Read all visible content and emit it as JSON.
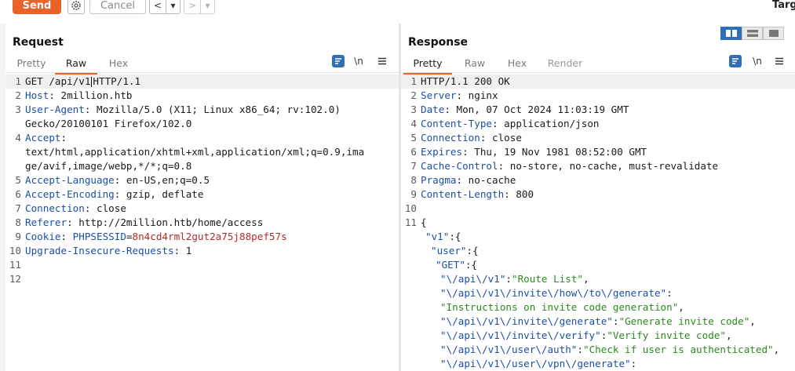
{
  "toolbar": {
    "send_label": "Send",
    "cancel_label": "Cancel",
    "back_label": "<",
    "back_dropdown_label": "▾",
    "forward_label": ">",
    "forward_dropdown_label": "▾",
    "target_label": "Targ"
  },
  "request": {
    "title": "Request",
    "tabs": [
      "Pretty",
      "Raw",
      "Hex"
    ],
    "active_tab": "Raw",
    "newline_label": "\\n",
    "lines": {
      "l1_a": "GET /api/v1",
      "l1_b": "HTTP/1.1",
      "l2_k": "Host",
      "l2_v": "2million.htb",
      "l3_k": "User-Agent",
      "l3_v": "Mozilla/5.0 (X11; Linux x86_64; rv:102.0)",
      "l3_c": "Gecko/20100101 Firefox/102.0",
      "l4_k": "Accept",
      "l4_c1": "text/html,application/xhtml+xml,application/xml;q=0.9,ima",
      "l4_c2": "ge/avif,image/webp,*/*;q=0.8",
      "l5_k": "Accept-Language",
      "l5_v": "en-US,en;q=0.5",
      "l6_k": "Accept-Encoding",
      "l6_v": "gzip, deflate",
      "l7_k": "Connection",
      "l7_v": "close",
      "l8_k": "Referer",
      "l8_v": "http://2million.htb/home/access",
      "l9_k": "Cookie",
      "l9_ck": "PHPSESSID",
      "l9_cv": "8n4cd4rml2gut2a75j88pef57s",
      "l10_k": "Upgrade-Insecure-Requests",
      "l10_v": "1"
    }
  },
  "response": {
    "title": "Response",
    "tabs": [
      "Pretty",
      "Raw",
      "Hex",
      "Render"
    ],
    "active_tab": "Pretty",
    "newline_label": "\\n",
    "lines": {
      "l1": "HTTP/1.1 200 OK",
      "l2_k": "Server",
      "l2_v": "nginx",
      "l3_k": "Date",
      "l3_v": "Mon, 07 Oct 2024 11:03:19 GMT",
      "l4_k": "Content-Type",
      "l4_v": "application/json",
      "l5_k": "Connection",
      "l5_v": "close",
      "l6_k": "Expires",
      "l6_v": "Thu, 19 Nov 1981 08:52:00 GMT",
      "l7_k": "Cache-Control",
      "l7_v": "no-store, no-cache, must-revalidate",
      "l8_k": "Pragma",
      "l8_v": "no-cache",
      "l9_k": "Content-Length",
      "l9_v": "800",
      "l11": "{",
      "j_v1": "\"v1\"",
      "j_user": "\"user\"",
      "j_get": "\"GET\"",
      "j_k1": "\"\\/api\\/v1\"",
      "j_v1s": "\"Route List\"",
      "j_k2": "\"\\/api\\/v1\\/invite\\/how\\/to\\/generate\"",
      "j_v2s": "\"Instructions on invite code generation\"",
      "j_k3": "\"\\/api\\/v1\\/invite\\/generate\"",
      "j_v3s": "\"Generate invite code\"",
      "j_k4": "\"\\/api\\/v1\\/invite\\/verify\"",
      "j_v4s": "\"Verify invite code\"",
      "j_k5": "\"\\/api\\/v1\\/user\\/auth\"",
      "j_v5s": "\"Check if user is authenticated\"",
      "j_k6": "\"\\/api\\/v1\\/user\\/vpn\\/generate\""
    }
  },
  "colors": {
    "accent": "#e8622a",
    "header_key": "#1b4ea8",
    "cookie_value": "#b52a2a",
    "json_string": "#2b8a1f",
    "icon_blue": "#2f6fb5"
  }
}
